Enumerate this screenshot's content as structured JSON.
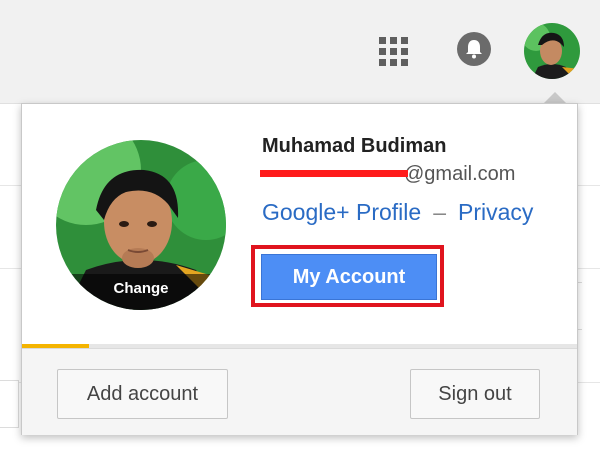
{
  "topbar": {
    "apps_icon": "apps-grid-icon",
    "notifications_icon": "notifications-bell-icon",
    "avatar_icon": "account-avatar-icon"
  },
  "account_menu": {
    "name": "Muhamad Budiman",
    "email_domain": "@gmail.com",
    "avatar_overlay_label": "Change",
    "links": {
      "profile": "Google+ Profile",
      "separator": "–",
      "privacy": "Privacy"
    },
    "primary_button": "My Account",
    "progress": 0.12,
    "footer": {
      "add_account": "Add account",
      "sign_out": "Sign out"
    }
  },
  "colors": {
    "accent_blue": "#4d8ef5",
    "highlight_red": "#e0141e",
    "link_blue": "#2a6bc4",
    "progress_yellow": "#f4b400"
  }
}
